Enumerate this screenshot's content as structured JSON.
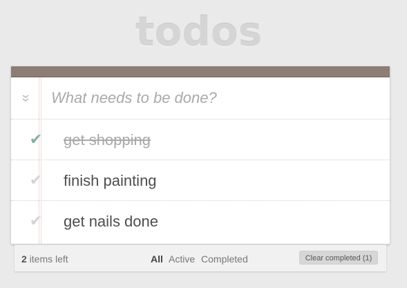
{
  "app": {
    "title": "todos"
  },
  "new_todo": {
    "placeholder": "What needs to be done?",
    "value": ""
  },
  "toggle_all": {
    "icon": "double-chevron-down-icon",
    "glyph": "»"
  },
  "todos": [
    {
      "label": "get shopping",
      "completed": true,
      "check": "✔"
    },
    {
      "label": "finish painting",
      "completed": false,
      "check": "✔"
    },
    {
      "label": "get nails done",
      "completed": false,
      "check": "✔"
    }
  ],
  "footer": {
    "count": "2",
    "count_suffix": " items left",
    "filters": [
      "All",
      "Active",
      "Completed"
    ],
    "selected_filter": "All",
    "clear_label": "Clear completed (1)"
  },
  "colors": {
    "header_bar": "#8d7d77",
    "completed_check": "#85ada7",
    "background": "#eaeaea"
  }
}
